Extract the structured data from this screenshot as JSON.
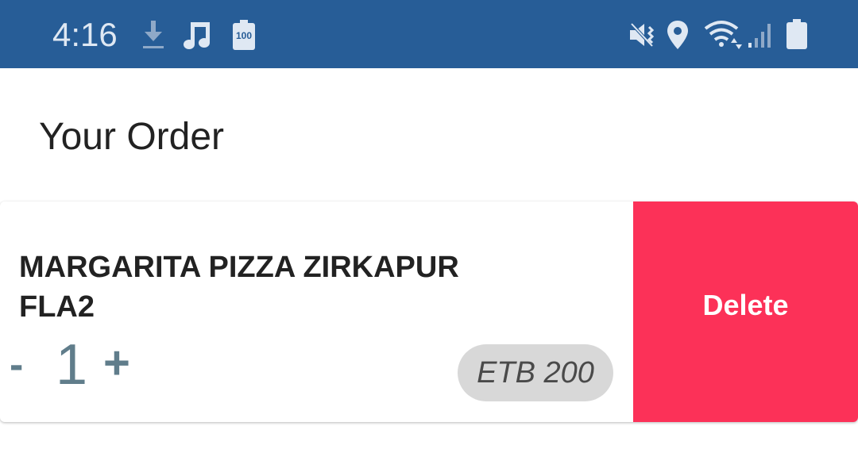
{
  "status_bar": {
    "time": "4:16",
    "battery_level_text": "100",
    "icons": [
      "download-icon",
      "music-note-icon",
      "battery-100-icon",
      "mute-icon",
      "location-icon",
      "wifi-icon",
      "signal-icon",
      "battery-icon"
    ],
    "background_color": "#275d97"
  },
  "page": {
    "title": "Your Order"
  },
  "order_item": {
    "name": "MARGARITA PIZZA ZIRKAPUR FLA2",
    "quantity_minus": "-",
    "quantity": "1",
    "quantity_plus": "+",
    "price": "ETB 200",
    "delete_label": "Delete",
    "delete_color": "#fc3158"
  }
}
